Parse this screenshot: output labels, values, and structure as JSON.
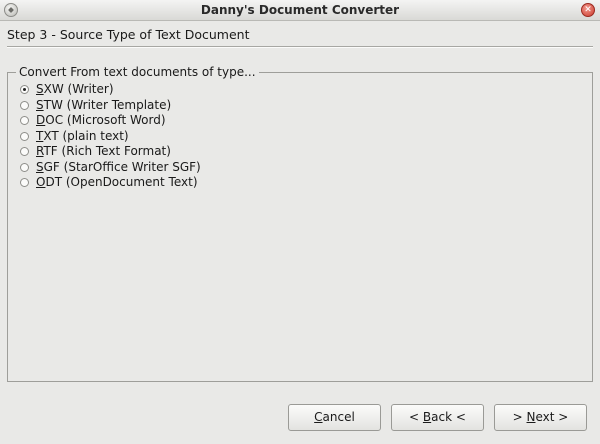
{
  "window": {
    "title": "Danny's Document Converter",
    "menu_icon": "window-menu-icon",
    "close_icon": "close-icon",
    "close_glyph": "✕"
  },
  "step": {
    "title": "Step 3 - Source Type of Text Document"
  },
  "group": {
    "legend": "Convert From text documents of type...",
    "selected": "SXW",
    "options": [
      {
        "mnemonic": "S",
        "rest": "XW (Writer)",
        "checked": true
      },
      {
        "mnemonic": "S",
        "rest": "TW (Writer Template)",
        "checked": false
      },
      {
        "mnemonic": "D",
        "rest": "OC (Microsoft Word)",
        "checked": false
      },
      {
        "mnemonic": "T",
        "rest": "XT (plain text)",
        "checked": false
      },
      {
        "mnemonic": "R",
        "rest": "TF (Rich Text Format)",
        "checked": false
      },
      {
        "mnemonic": "S",
        "rest": "GF (StarOffice Writer SGF)",
        "checked": false
      },
      {
        "mnemonic": "O",
        "rest": "DT (OpenDocument Text)",
        "checked": false
      }
    ]
  },
  "buttons": {
    "cancel": {
      "mnemonic": "C",
      "rest": "ancel"
    },
    "back": {
      "prefix": "< ",
      "mnemonic": "B",
      "rest": "ack <"
    },
    "next": {
      "prefix": "> ",
      "mnemonic": "N",
      "rest": "ext >"
    }
  }
}
